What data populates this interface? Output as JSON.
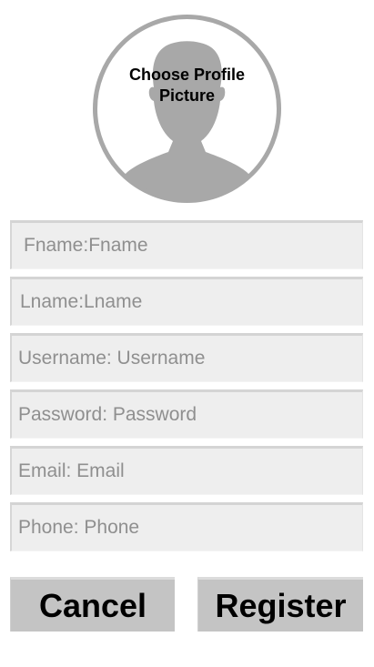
{
  "profile": {
    "picture_label": "Choose Profile Picture",
    "icon": "avatar-placeholder-icon",
    "ring_color": "#a8a8a8"
  },
  "form": {
    "fields": [
      {
        "name": "fname",
        "placeholder": "Fname:Fname"
      },
      {
        "name": "lname",
        "placeholder": "Lname:Lname"
      },
      {
        "name": "username",
        "placeholder": "Username: Username"
      },
      {
        "name": "password",
        "placeholder": "Password: Password"
      },
      {
        "name": "email",
        "placeholder": "Email: Email"
      },
      {
        "name": "phone",
        "placeholder": "Phone: Phone"
      }
    ]
  },
  "actions": {
    "cancel_label": "Cancel",
    "register_label": "Register",
    "button_color": "#c4c4c4"
  }
}
